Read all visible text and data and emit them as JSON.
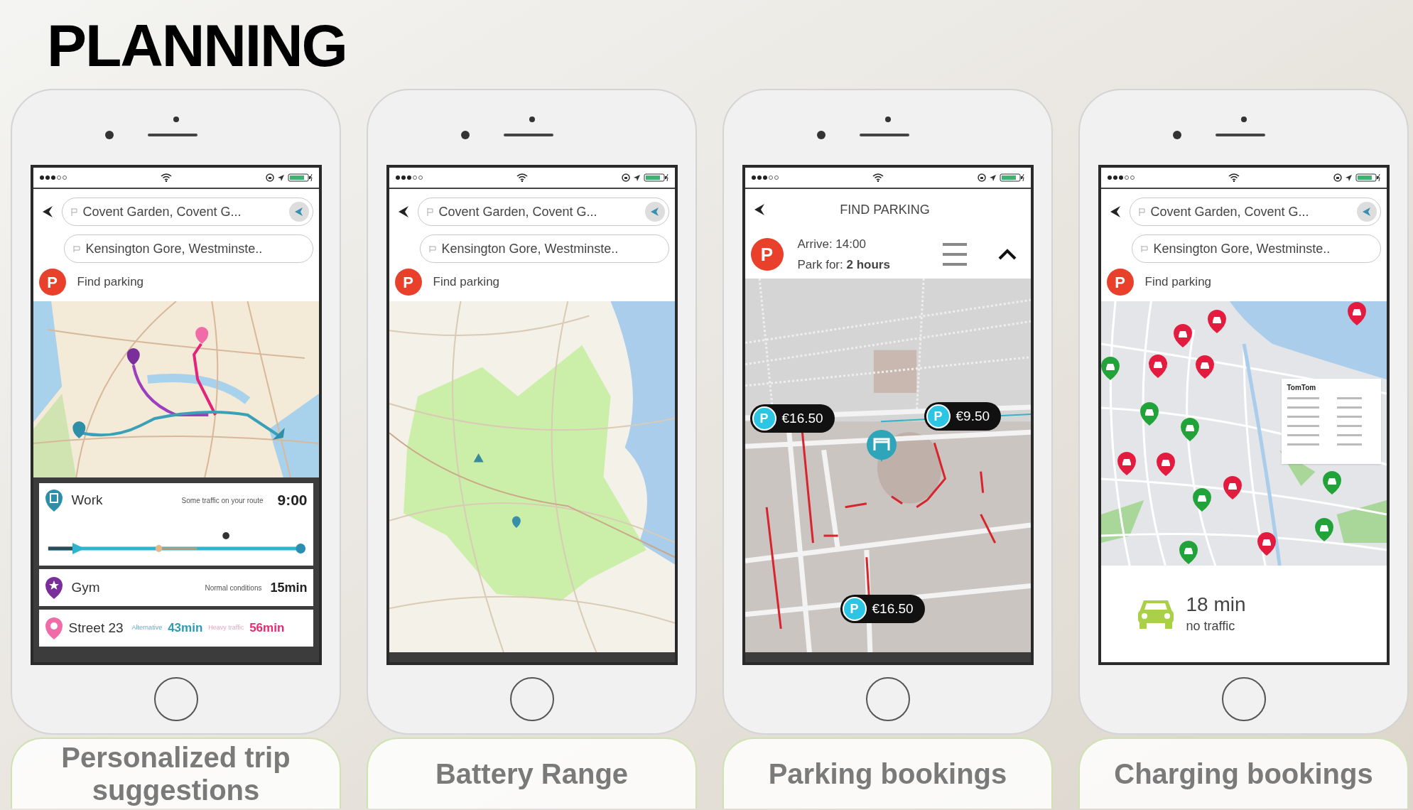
{
  "title": "PLANNING",
  "phones": [
    {
      "kind": "trips",
      "origin": "Covent Garden, Covent G...",
      "destination": "Kensington Gore, Westminste..",
      "parking_badge": "P",
      "parking_label": "Find parking",
      "trips": [
        {
          "kind": "work",
          "name": "Work",
          "note": "Some traffic on your route",
          "time": "9:00"
        },
        {
          "kind": "gym",
          "name": "Gym",
          "note": "Normal conditions",
          "time": "15min"
        },
        {
          "kind": "street",
          "name": "Street 23",
          "alternative_label": "Alternative",
          "alternative_time": "43min",
          "heavy_label": "Heavy traffic",
          "heavy_time": "56min"
        }
      ],
      "caption": "Personalized trip suggestions"
    },
    {
      "kind": "range",
      "origin": "Covent Garden, Covent G...",
      "destination": "Kensington Gore, Westminste..",
      "parking_badge": "P",
      "parking_label": "Find parking",
      "caption": "Battery Range"
    },
    {
      "kind": "parking",
      "header": "FIND PARKING",
      "parking_badge": "P",
      "arrive": "Arrive: 14:00",
      "park_for": "Park for: **2 hours**",
      "prices": [
        {
          "badge": "P",
          "price": "€16.50"
        },
        {
          "badge": "P",
          "price": "€9.50"
        },
        {
          "badge": "P",
          "price": "€16.50"
        }
      ],
      "caption": "Parking bookings"
    },
    {
      "kind": "charging",
      "origin": "Covent Garden, Covent G...",
      "destination": "Kensington Gore, Westminste..",
      "parking_badge": "P",
      "parking_label": "Find parking",
      "popup_brand": "TomTom",
      "chargers": [
        {
          "color": "#e31b3f"
        },
        {
          "color": "#e31b3f"
        },
        {
          "color": "#e31b3f"
        },
        {
          "color": "#e31b3f"
        },
        {
          "color": "#e31b3f"
        },
        {
          "color": "#e31b3f"
        },
        {
          "color": "#e31b3f"
        },
        {
          "color": "#e31b3f"
        },
        {
          "color": "#e31b3f"
        },
        {
          "color": "#22a33a"
        },
        {
          "color": "#22a33a"
        },
        {
          "color": "#22a33a"
        },
        {
          "color": "#22a33a"
        },
        {
          "color": "#22a33a"
        },
        {
          "color": "#22a33a"
        },
        {
          "color": "#22a33a"
        }
      ],
      "duration": "18 min",
      "traffic": "no traffic",
      "caption": "Charging bookings"
    }
  ]
}
